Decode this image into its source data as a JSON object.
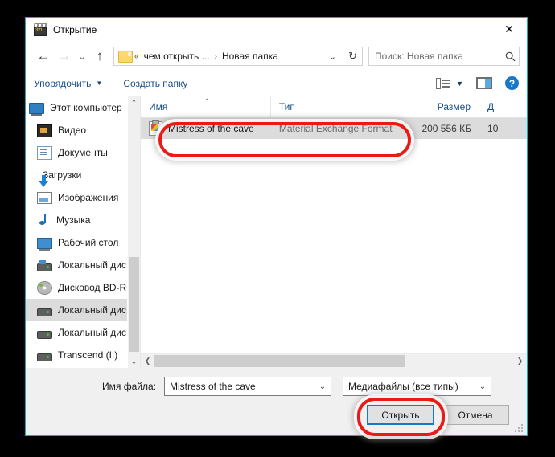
{
  "window": {
    "title": "Открытие",
    "title_icon": "media-clapperboard-icon",
    "close_label": "✕"
  },
  "nav": {
    "back": "←",
    "forward": "→",
    "recent": "⌄",
    "up": "↑",
    "breadcrumbs": [
      {
        "label": "«",
        "type": "overflow"
      },
      {
        "label": "чем открыть ...",
        "type": "crumb"
      },
      {
        "label": "›",
        "type": "sep"
      },
      {
        "label": "Новая папка",
        "type": "crumb"
      }
    ],
    "address_chevron": "⌄",
    "refresh": "↻"
  },
  "search": {
    "placeholder": "Поиск: Новая папка",
    "value": "",
    "icon": "search-icon"
  },
  "toolbar": {
    "organize_label": "Упорядочить",
    "organize_caret": "▼",
    "new_folder_label": "Создать папку",
    "view_caret": "▼",
    "help_label": "?"
  },
  "sidebar": {
    "items": [
      {
        "label": "Этот компьютер",
        "icon": "computer-icon",
        "icon_class": "ico-pc",
        "selected": false,
        "root": true
      },
      {
        "label": "Видео",
        "icon": "video-folder-icon",
        "icon_class": "ico-video",
        "selected": false,
        "root": false
      },
      {
        "label": "Документы",
        "icon": "documents-folder-icon",
        "icon_class": "ico-doc",
        "selected": false,
        "root": false
      },
      {
        "label": "Загрузки",
        "icon": "downloads-folder-icon",
        "icon_class": "ico-down",
        "selected": false,
        "root": false
      },
      {
        "label": "Изображения",
        "icon": "pictures-folder-icon",
        "icon_class": "ico-img",
        "selected": false,
        "root": false
      },
      {
        "label": "Музыка",
        "icon": "music-folder-icon",
        "icon_class": "ico-music",
        "selected": false,
        "root": false
      },
      {
        "label": "Рабочий стол",
        "icon": "desktop-folder-icon",
        "icon_class": "ico-desktop",
        "selected": false,
        "root": false
      },
      {
        "label": "Локальный дис",
        "icon": "system-drive-icon",
        "icon_class": "ico-drive-sys",
        "selected": false,
        "root": false
      },
      {
        "label": "Дисковод BD-RO",
        "icon": "optical-drive-icon",
        "icon_class": "ico-cd",
        "selected": false,
        "root": false
      },
      {
        "label": "Локальный дис",
        "icon": "drive-icon",
        "icon_class": "ico-drive",
        "selected": true,
        "root": false
      },
      {
        "label": "Локальный дис",
        "icon": "drive-icon",
        "icon_class": "ico-drive",
        "selected": false,
        "root": false
      },
      {
        "label": "Transcend (I:)",
        "icon": "drive-icon",
        "icon_class": "ico-drive",
        "selected": false,
        "root": false
      },
      {
        "label": "Transcend (I:)",
        "icon": "drive-icon",
        "icon_class": "ico-drive",
        "selected": false,
        "root": true
      }
    ],
    "scroll_up": "⌃",
    "scroll_down": "⌄"
  },
  "file_list": {
    "columns": [
      {
        "key": "name",
        "label": "Имя",
        "sorted": true
      },
      {
        "key": "type",
        "label": "Тип",
        "sorted": false
      },
      {
        "key": "size",
        "label": "Размер",
        "sorted": false
      },
      {
        "key": "date",
        "label": "Д",
        "sorted": false
      }
    ],
    "sort_caret": "⌃",
    "rows": [
      {
        "name": "Mistress of the cave",
        "type": "Material Exchange Format",
        "size": "200 556 КБ",
        "date": "10",
        "icon": "media-file-icon",
        "selected": true
      }
    ],
    "hscroll_left": "❮",
    "hscroll_right": "❯"
  },
  "footer": {
    "filename_label": "Имя файла:",
    "filename_value": "Mistress of the cave",
    "filename_arrow": "⌄",
    "filter_value": "Медиафайлы (все типы)",
    "filter_arrow": "⌄",
    "open_button": "Открыть",
    "cancel_button": "Отмена"
  },
  "annotations": {
    "color": "#e81b18",
    "file_row_highlight": "highlight-selected-file",
    "open_button_highlight": "highlight-open-button"
  }
}
